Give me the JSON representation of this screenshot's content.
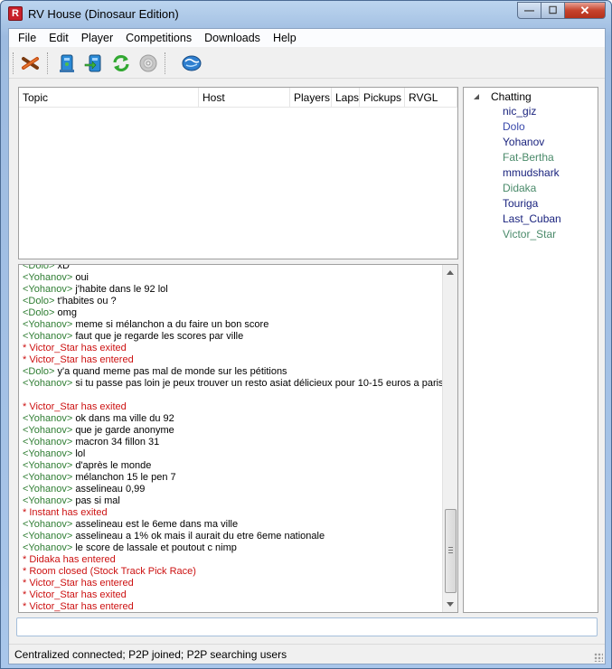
{
  "window": {
    "title": "RV House (Dinosaur Edition)",
    "controls": {
      "minimize": "—",
      "maximize": "☐",
      "close": "✕"
    }
  },
  "menu": [
    {
      "label": "File"
    },
    {
      "label": "Edit"
    },
    {
      "label": "Player"
    },
    {
      "label": "Competitions"
    },
    {
      "label": "Downloads"
    },
    {
      "label": "Help"
    }
  ],
  "toolbar": [
    {
      "icon": "disconnect-icon"
    },
    {
      "icon": "host-icon"
    },
    {
      "icon": "join-icon"
    },
    {
      "icon": "refresh-icon"
    },
    {
      "icon": "cd-icon"
    },
    {
      "icon": "globe-icon"
    }
  ],
  "topics": {
    "columns": [
      "Topic",
      "Host",
      "Players",
      "Laps",
      "Pickups",
      "RVGL"
    ],
    "rows": []
  },
  "users": {
    "group": "Chatting",
    "list": [
      {
        "name": "nic_giz",
        "color": "#1a237e"
      },
      {
        "name": "Dolo",
        "color": "#3949ab"
      },
      {
        "name": "Yohanov",
        "color": "#1a237e"
      },
      {
        "name": "Fat-Bertha",
        "color": "#4a8a6a"
      },
      {
        "name": "mmudshark",
        "color": "#1a237e"
      },
      {
        "name": "Didaka",
        "color": "#4a8a6a"
      },
      {
        "name": "Touriga",
        "color": "#1a237e"
      },
      {
        "name": "Last_Cuban",
        "color": "#1a237e"
      },
      {
        "name": "Victor_Star",
        "color": "#4a8a6a"
      }
    ]
  },
  "chat": [
    {
      "type": "msg",
      "nick": "<Dolo>",
      "text": " xD"
    },
    {
      "type": "msg",
      "nick": "<Yohanov>",
      "text": " oui"
    },
    {
      "type": "msg",
      "nick": "<Yohanov>",
      "text": " j'habite dans le 92 lol"
    },
    {
      "type": "msg",
      "nick": "<Dolo>",
      "text": " t'habites ou ?"
    },
    {
      "type": "msg",
      "nick": "<Dolo>",
      "text": " omg"
    },
    {
      "type": "msg",
      "nick": "<Yohanov>",
      "text": " meme si mélanchon a du faire un bon score"
    },
    {
      "type": "msg",
      "nick": "<Yohanov>",
      "text": " faut que je regarde  les scores par ville"
    },
    {
      "type": "sys",
      "text": "* Victor_Star has exited"
    },
    {
      "type": "sys",
      "text": "* Victor_Star has entered"
    },
    {
      "type": "msg",
      "nick": "<Dolo>",
      "text": " y'a quand meme pas mal de monde sur les pétitions"
    },
    {
      "type": "msg",
      "nick": "<Yohanov>",
      "text": " si tu passe pas loin je peux trouver un resto asiat délicieux pour 10-15 euros a paris",
      "wrap": true
    },
    {
      "type": "sys",
      "text": "* Victor_Star has exited"
    },
    {
      "type": "msg",
      "nick": "<Yohanov>",
      "text": " ok dans ma ville du 92"
    },
    {
      "type": "msg",
      "nick": "<Yohanov>",
      "text": " que je garde anonyme"
    },
    {
      "type": "msg",
      "nick": "<Yohanov>",
      "text": " macron 34 fillon 31"
    },
    {
      "type": "msg",
      "nick": "<Yohanov>",
      "text": " lol"
    },
    {
      "type": "msg",
      "nick": "<Yohanov>",
      "text": " d'après le monde"
    },
    {
      "type": "msg",
      "nick": "<Yohanov>",
      "text": " mélanchon 15 le pen 7"
    },
    {
      "type": "msg",
      "nick": "<Yohanov>",
      "text": " asselineau 0,99"
    },
    {
      "type": "msg",
      "nick": "<Yohanov>",
      "text": " pas si mal"
    },
    {
      "type": "sys",
      "text": "* Instant has exited"
    },
    {
      "type": "msg",
      "nick": "<Yohanov>",
      "text": " asselineau est le 6eme dans ma ville"
    },
    {
      "type": "msg",
      "nick": "<Yohanov>",
      "text": " asselineau a 1% ok mais il aurait du etre 6eme nationale"
    },
    {
      "type": "msg",
      "nick": "<Yohanov>",
      "text": " le score de lassale et poutout c nimp"
    },
    {
      "type": "sys",
      "text": "* Didaka has entered"
    },
    {
      "type": "sys",
      "text": "* Room closed (Stock Track Pick Race)"
    },
    {
      "type": "sys",
      "text": "* Victor_Star has entered"
    },
    {
      "type": "sys",
      "text": "* Victor_Star has exited"
    },
    {
      "type": "sys",
      "text": "* Victor_Star has entered"
    }
  ],
  "input": {
    "value": ""
  },
  "status": "Centralized connected; P2P joined; P2P searching users",
  "colors": {
    "nick": "#2e7d32",
    "system": "#cc1111"
  }
}
